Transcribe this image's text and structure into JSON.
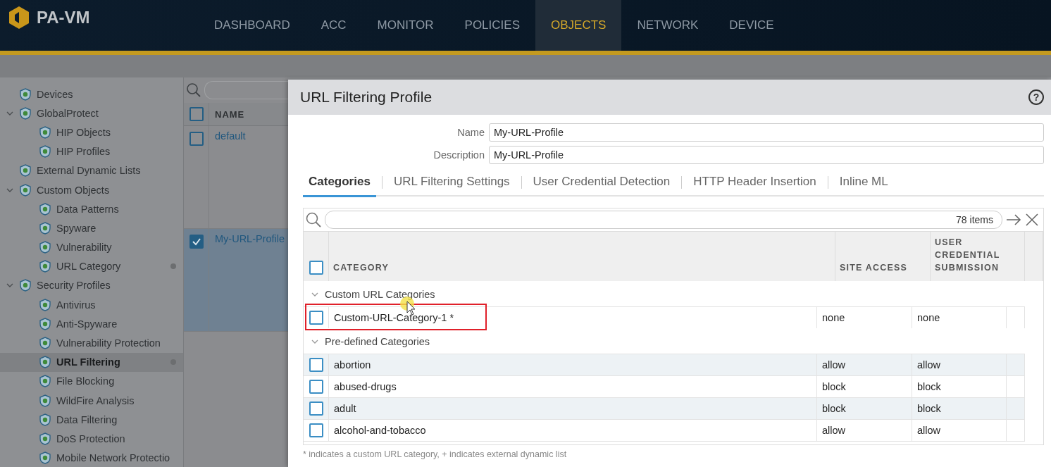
{
  "app": {
    "logo": "PA-VM"
  },
  "nav": [
    {
      "label": "DASHBOARD",
      "selected": false
    },
    {
      "label": "ACC",
      "selected": false
    },
    {
      "label": "MONITOR",
      "selected": false
    },
    {
      "label": "POLICIES",
      "selected": false
    },
    {
      "label": "OBJECTS",
      "selected": true
    },
    {
      "label": "NETWORK",
      "selected": false
    },
    {
      "label": "DEVICE",
      "selected": false
    }
  ],
  "sidebar": {
    "items": [
      {
        "label": "Devices",
        "selected": false,
        "dot": false
      },
      {
        "label": "GlobalProtect",
        "selected": false,
        "dot": false,
        "expanded": true,
        "children": [
          {
            "label": "HIP Objects",
            "selected": false,
            "dot": false
          },
          {
            "label": "HIP Profiles",
            "selected": false,
            "dot": false
          }
        ]
      },
      {
        "label": "External Dynamic Lists",
        "selected": false,
        "dot": false
      },
      {
        "label": "Custom Objects",
        "selected": false,
        "dot": false,
        "expanded": true,
        "children": [
          {
            "label": "Data Patterns",
            "selected": false,
            "dot": false
          },
          {
            "label": "Spyware",
            "selected": false,
            "dot": false
          },
          {
            "label": "Vulnerability",
            "selected": false,
            "dot": false
          },
          {
            "label": "URL Category",
            "selected": false,
            "dot": true
          }
        ]
      },
      {
        "label": "Security Profiles",
        "selected": false,
        "dot": false,
        "expanded": true,
        "children": [
          {
            "label": "Antivirus",
            "selected": false,
            "dot": false
          },
          {
            "label": "Anti-Spyware",
            "selected": false,
            "dot": false
          },
          {
            "label": "Vulnerability Protection",
            "selected": false,
            "dot": false
          },
          {
            "label": "URL Filtering",
            "selected": true,
            "dot": true
          },
          {
            "label": "File Blocking",
            "selected": false,
            "dot": false
          },
          {
            "label": "WildFire Analysis",
            "selected": false,
            "dot": false
          },
          {
            "label": "Data Filtering",
            "selected": false,
            "dot": false
          },
          {
            "label": "DoS Protection",
            "selected": false,
            "dot": false
          },
          {
            "label": "Mobile Network Protectio",
            "selected": false,
            "dot": false
          }
        ]
      }
    ]
  },
  "list": {
    "header": "NAME",
    "header_checked": false,
    "rows": [
      {
        "name": "default",
        "checked": false,
        "selected": false
      },
      {
        "name": "My-URL-Profile",
        "checked": true,
        "selected": true
      }
    ]
  },
  "dialog": {
    "title": "URL Filtering Profile",
    "help": "?",
    "fields": [
      {
        "label": "Name",
        "value": "My-URL-Profile"
      },
      {
        "label": "Description",
        "value": "My-URL-Profile"
      }
    ],
    "tabs": [
      {
        "label": "Categories",
        "selected": true
      },
      {
        "label": "URL Filtering Settings",
        "selected": false
      },
      {
        "label": "User Credential Detection",
        "selected": false
      },
      {
        "label": "HTTP Header Insertion",
        "selected": false
      },
      {
        "label": "Inline ML",
        "selected": false
      }
    ],
    "table": {
      "count": "78 items",
      "header_checked": false,
      "columns": [
        "CATEGORY",
        "SITE ACCESS",
        "USER CREDENTIAL SUBMISSION"
      ],
      "groups": [
        {
          "label": "Custom URL Categories",
          "expanded": true,
          "rows": [
            {
              "category": "Custom-URL-Category-1 *",
              "site_access": "none",
              "user_credential_submission": "none",
              "checked": false,
              "highlighted": true
            }
          ]
        },
        {
          "label": "Pre-defined Categories",
          "expanded": true,
          "rows": [
            {
              "category": "abortion",
              "site_access": "allow",
              "user_credential_submission": "allow",
              "checked": false,
              "highlighted": false
            },
            {
              "category": "abused-drugs",
              "site_access": "block",
              "user_credential_submission": "block",
              "checked": false,
              "highlighted": false
            },
            {
              "category": "adult",
              "site_access": "block",
              "user_credential_submission": "block",
              "checked": false,
              "highlighted": false
            },
            {
              "category": "alcohol-and-tobacco",
              "site_access": "allow",
              "user_credential_submission": "allow",
              "checked": false,
              "highlighted": false
            }
          ]
        }
      ]
    },
    "footnote": "* indicates a custom URL category, + indicates external dynamic list"
  }
}
